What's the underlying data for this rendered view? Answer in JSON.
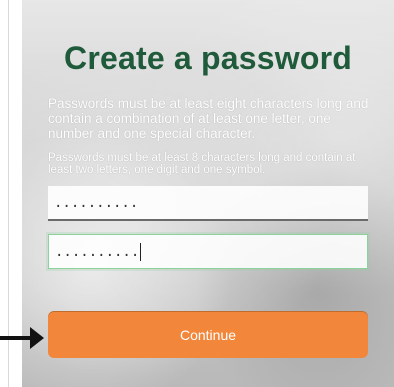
{
  "form": {
    "title": "Create a password",
    "requirements_primary": "Passwords must be at least eight characters long and contain a combination of at least one letter, one number and one special character.",
    "requirements_secondary": "Passwords must be at least 8 characters long and contain at least two letters, one digit and one symbol.",
    "password_value_masked": "..........",
    "confirm_value_masked": "..........",
    "continue_label": "Continue"
  },
  "colors": {
    "title": "#1f5a3a",
    "accent_button": "#f2873b"
  },
  "annotations": {
    "arrow_icon": "right-arrow-icon"
  }
}
